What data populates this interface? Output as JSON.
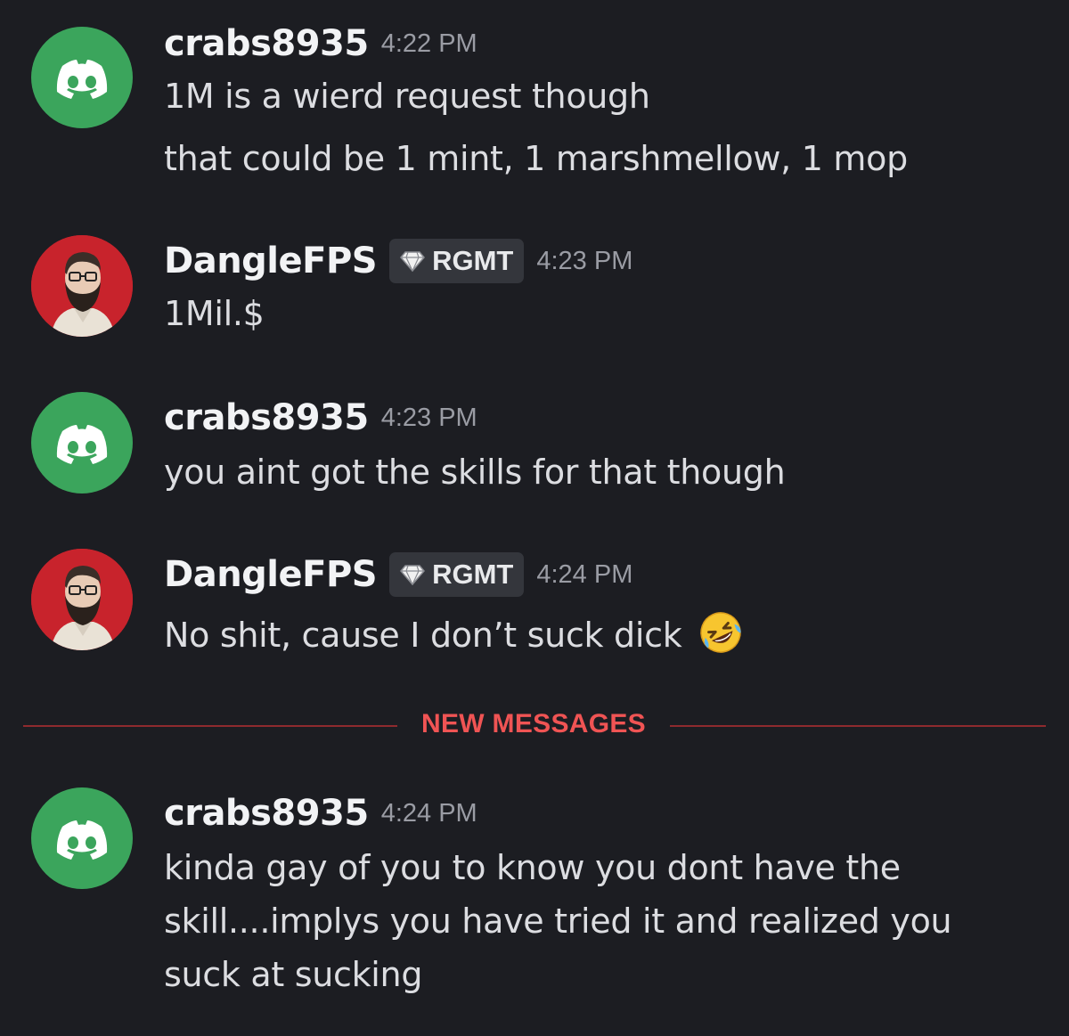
{
  "messages": [
    {
      "author": "crabs8935",
      "avatar": "discord-logo-icon",
      "timestamp": "4:22 PM",
      "lines": [
        "1M is a wierd request though",
        "that could be 1 mint, 1 marshmellow, 1 mop"
      ]
    },
    {
      "author": "DangleFPS",
      "avatar": "bearded-man-avatar",
      "tag": "RGMT",
      "tag_icon": "diamond-icon",
      "timestamp": "4:23 PM",
      "lines": [
        "1Mil.$"
      ]
    },
    {
      "author": "crabs8935",
      "avatar": "discord-logo-icon",
      "timestamp": "4:23 PM",
      "lines": [
        "you aint got the skills for that though"
      ]
    },
    {
      "author": "DangleFPS",
      "avatar": "bearded-man-avatar",
      "tag": "RGMT",
      "tag_icon": "diamond-icon",
      "timestamp": "4:24 PM",
      "lines": [
        "No shit, cause I don’t suck dick"
      ],
      "emoji": "rolling-on-floor-laughing-emoji"
    },
    {
      "author": "crabs8935",
      "avatar": "discord-logo-icon",
      "timestamp": "4:24 PM",
      "lines": [
        "kinda gay of you to know you dont have the",
        "skill....implys you have tried it and realized you",
        "suck at sucking"
      ]
    }
  ],
  "divider": {
    "label": "NEW MESSAGES"
  },
  "colors": {
    "background": "#1c1d22",
    "discord_green": "#3ba55c",
    "new_messages_red": "#f05454",
    "divider_line": "#8e2a2e",
    "tag_background": "#34363c"
  }
}
